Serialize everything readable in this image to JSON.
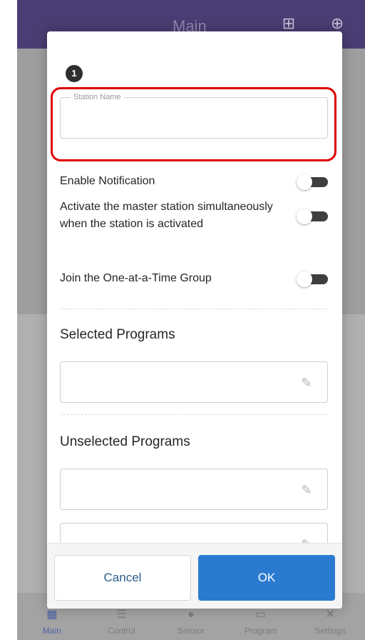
{
  "app": {
    "title": "Main",
    "header_icons": [
      "add-task-icon",
      "globe-icon"
    ],
    "nav": [
      {
        "label": "Main",
        "icon": "grid-icon",
        "active": true
      },
      {
        "label": "Control",
        "icon": "sliders-icon",
        "active": false
      },
      {
        "label": "Sensor",
        "icon": "sensor-icon",
        "active": false
      },
      {
        "label": "Program",
        "icon": "calendar-icon",
        "active": false
      },
      {
        "label": "Settings",
        "icon": "tools-icon",
        "active": false
      }
    ]
  },
  "dialog": {
    "station_number": "1",
    "station_name": {
      "label": "Station Name",
      "value": ""
    },
    "options": [
      {
        "label": "Enable Notification",
        "enabled": false
      },
      {
        "label": "Activate the master station simultaneously when the station is activated",
        "enabled": false
      },
      {
        "label": "Join the One-at-a-Time Group",
        "enabled": false
      }
    ],
    "selected_programs": {
      "title": "Selected Programs"
    },
    "unselected_programs": {
      "title": "Unselected Programs"
    },
    "buttons": {
      "cancel": "Cancel",
      "ok": "OK"
    }
  },
  "colors": {
    "header": "#4a3d73",
    "primary": "#2a7bd0",
    "highlight": "#e00000"
  }
}
